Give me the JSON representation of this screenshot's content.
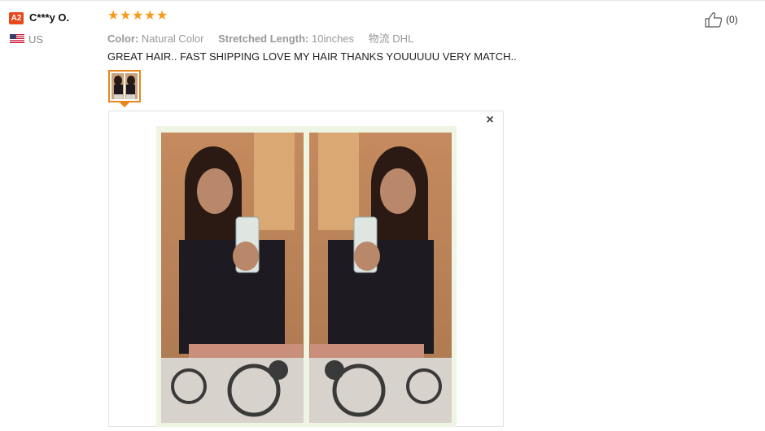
{
  "reviewer": {
    "badge": "A2",
    "name": "C***y O.",
    "country": "US"
  },
  "rating": {
    "stars": 5,
    "max": 5
  },
  "attributes": {
    "color_key": "Color:",
    "color_value": "Natural Color",
    "length_key": "Stretched Length:",
    "length_value": "10inches",
    "shipping_key": "物流",
    "shipping_value": "DHL"
  },
  "review_text": "GREAT HAIR.. FAST SHIPPING LOVE MY HAIR THANKS YOUUUUU VERY MATCH..",
  "helpful": {
    "count_label": "(0)"
  },
  "viewer": {
    "close_glyph": "×"
  },
  "colors": {
    "accent": "#e8881b",
    "star": "#f79a1b",
    "badge": "#e8481b"
  }
}
